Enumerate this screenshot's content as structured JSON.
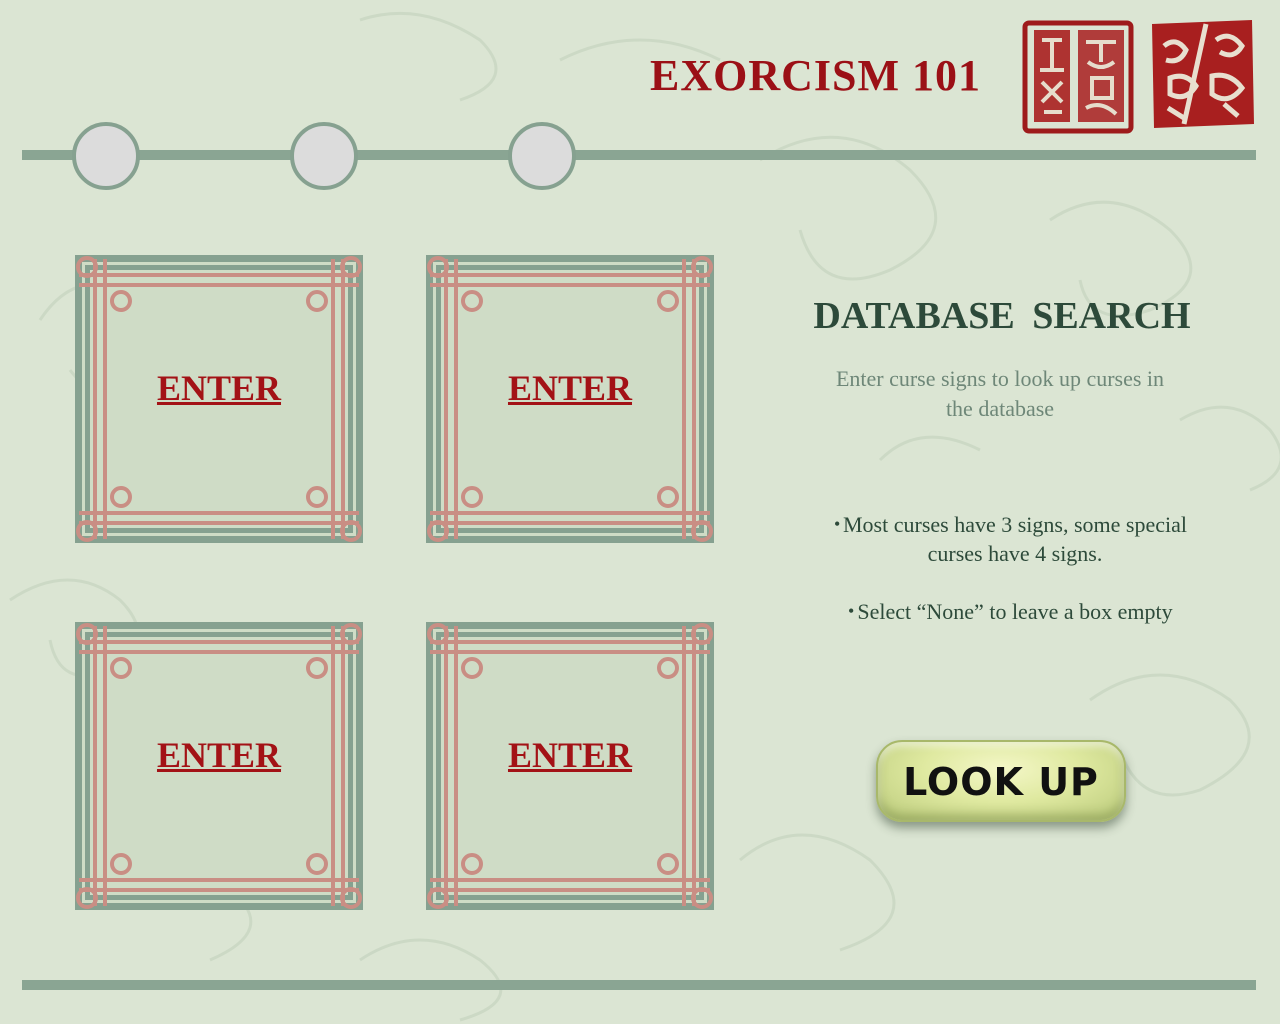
{
  "header": {
    "title": "EXORCISM 101",
    "seals": [
      "seal-stamp-left",
      "seal-stamp-right"
    ],
    "progress_steps": 3
  },
  "sign_boxes": [
    {
      "label": "ENTER"
    },
    {
      "label": "ENTER"
    },
    {
      "label": "ENTER"
    },
    {
      "label": "ENTER"
    }
  ],
  "panel": {
    "heading": "DATABASE  SEARCH",
    "description": "Enter curse signs to look up curses in the database",
    "tips": [
      "Most curses have 3 signs, some special curses have 4 signs.",
      "Select “None” to leave a box empty"
    ],
    "bullet": "•"
  },
  "lookup_button": {
    "label": "LOOK UP"
  },
  "colors": {
    "background": "#dbe5d3",
    "title_red": "#9b1016",
    "frame_green": "#86a190",
    "frame_pink": "#c98e84",
    "heading_green": "#2d4a3a",
    "button_yellow_green": "#dfe9a0"
  }
}
